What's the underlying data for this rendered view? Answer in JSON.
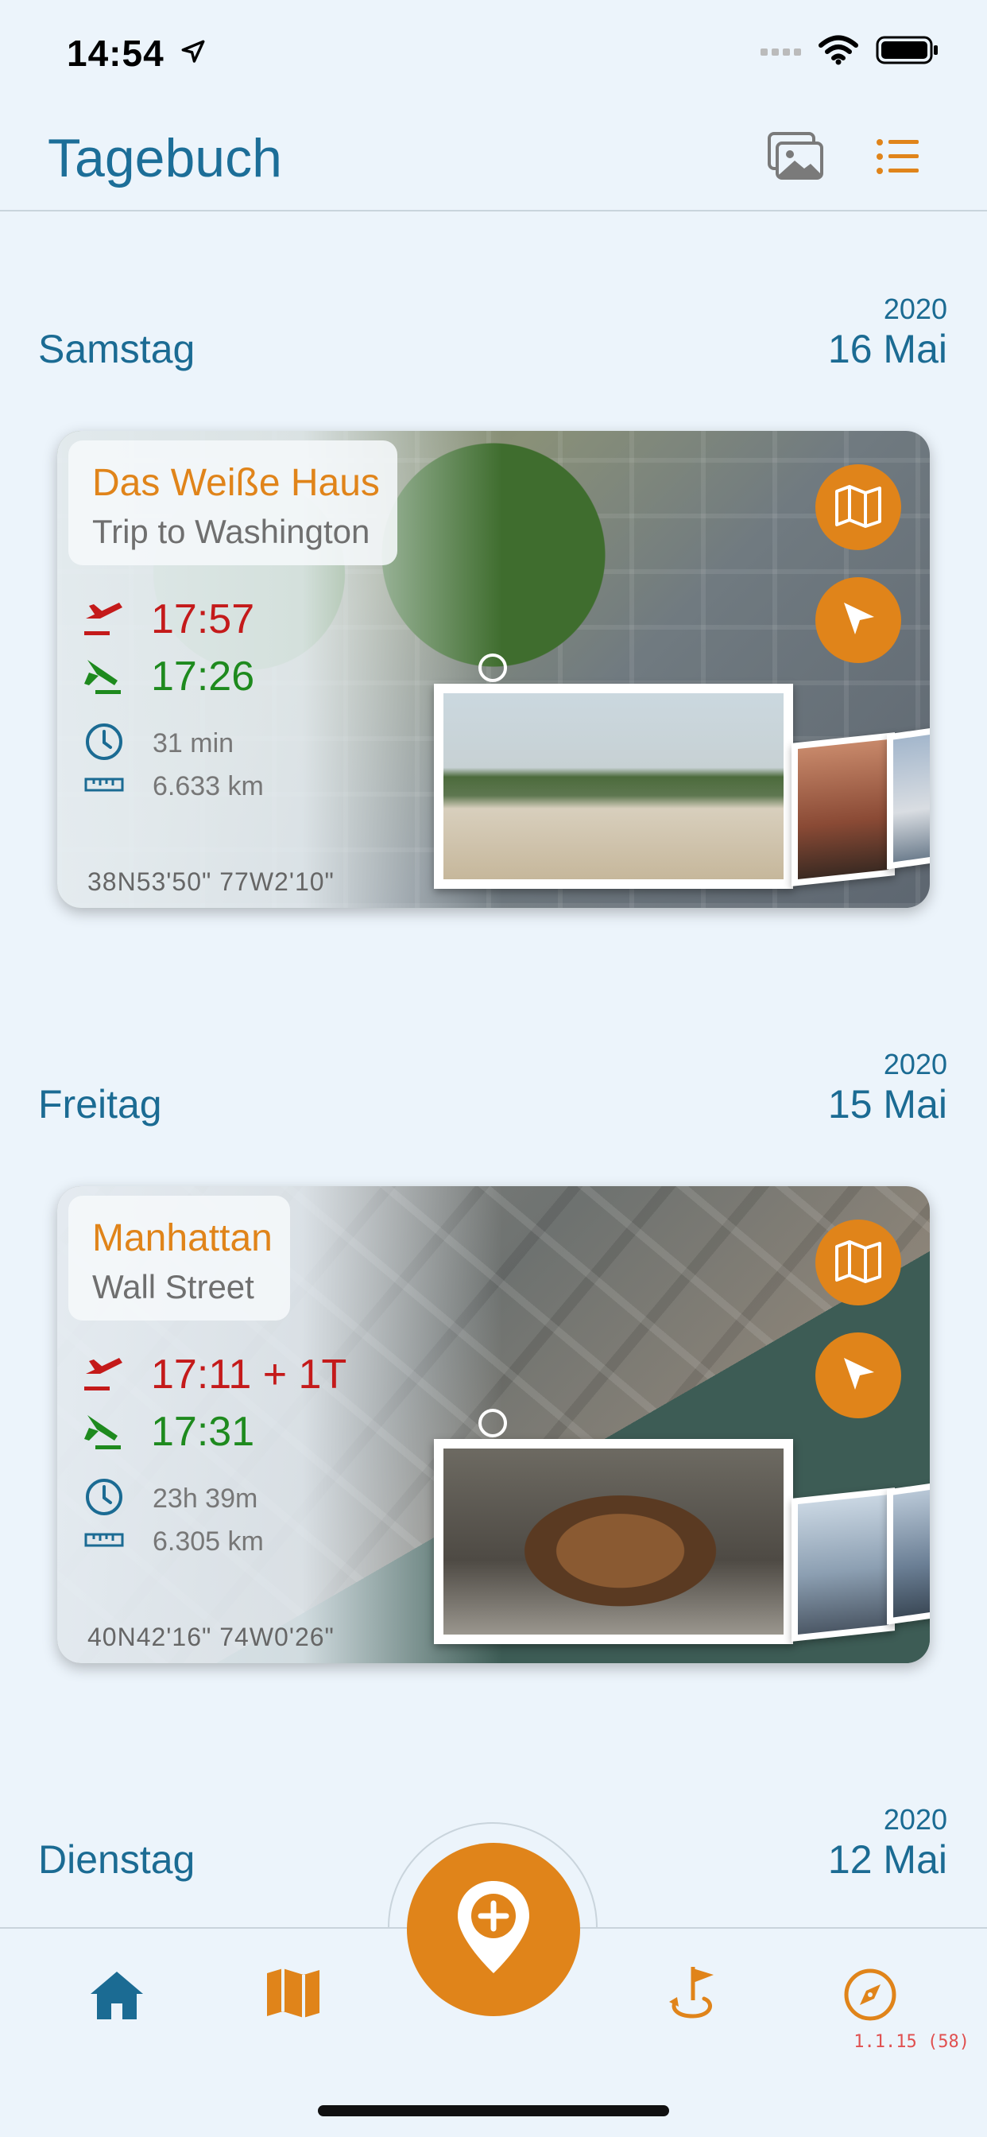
{
  "status_bar": {
    "time": "14:54"
  },
  "header": {
    "title": "Tagebuch"
  },
  "days": [
    {
      "weekday": "Samstag",
      "year": "2020",
      "date": "16 Mai"
    },
    {
      "weekday": "Freitag",
      "year": "2020",
      "date": "15 Mai"
    },
    {
      "weekday": "Dienstag",
      "year": "2020",
      "date": "12 Mai"
    }
  ],
  "entries": [
    {
      "title": "Das Weiße Haus",
      "subtitle": "Trip to Washington",
      "departure": "17:57",
      "arrival": "17:26",
      "duration": "31 min",
      "distance": "6.633 km",
      "coords": "38N53'50\"   77W2'10\""
    },
    {
      "title": "Manhattan",
      "subtitle": "Wall Street",
      "departure": "17:11 + 1T",
      "arrival": "17:31",
      "duration": "23h 39m",
      "distance": "6.305 km",
      "coords": "40N42'16\"   74W0'26\""
    }
  ],
  "tabbar": {
    "items": [
      "home-icon",
      "map-icon",
      "add-location-icon",
      "flag-return-icon",
      "compass-icon"
    ],
    "version": "1.1.15 (58)"
  },
  "colors": {
    "accent": "#e0841a",
    "primary": "#1b6b93",
    "departure": "#c41a1a",
    "arrival": "#1e8a1e",
    "background": "#ecf4fb"
  }
}
